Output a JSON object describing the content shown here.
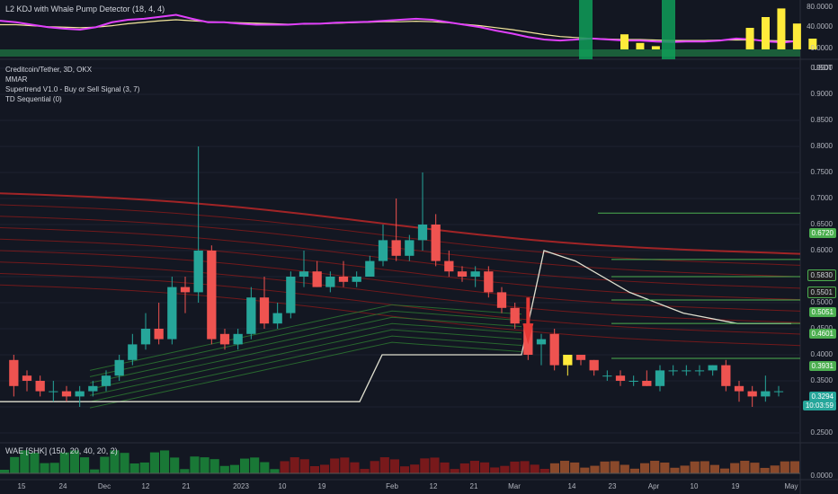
{
  "kdj_pane": {
    "title": "L2 KDJ with Whale Pump Detector (18, 4, 4)",
    "scale": [
      "80.0000",
      "40.0000",
      "0.0000"
    ]
  },
  "main_pane": {
    "legend": [
      "Creditcoin/Tether, 3D, OKX",
      "MMAR",
      "Supertrend V1.0 - Buy or Sell Signal (3, 7)",
      "TD Sequential (0)"
    ],
    "currency": "USDT",
    "scale": [
      "0.9500",
      "0.9000",
      "0.8500",
      "0.8000",
      "0.7500",
      "0.7000",
      "0.6500",
      "0.6000",
      "0.5500",
      "0.5000",
      "0.4500",
      "0.4000",
      "0.3500",
      "0.3000",
      "0.2500"
    ],
    "level_badges": [
      "0.6720",
      "0.5830",
      "0.5501",
      "0.5051",
      "0.4601",
      "0.3931"
    ],
    "last_price": "0.3294",
    "countdown": "10:03:59"
  },
  "wae_pane": {
    "title": "WAE [SHK] (150, 20, 40, 20, 2)",
    "scale": [
      "0.0000"
    ]
  },
  "time_axis": [
    "15",
    "24",
    "Dec",
    "12",
    "21",
    "2023",
    "10",
    "19",
    "Feb",
    "12",
    "21",
    "Mar",
    "14",
    "23",
    "Apr",
    "10",
    "19",
    "May"
  ],
  "colors": {
    "up": "#26a69a",
    "down": "#ef5350",
    "yellow": "#ffeb3b",
    "kdj_magenta": "#e040fb",
    "green_level": "#4caf50"
  },
  "chart_data": {
    "type": "candlestick",
    "title": "Creditcoin/Tether, 3D, OKX",
    "ylim": [
      0.25,
      0.95
    ],
    "candles": [
      {
        "o": 0.39,
        "h": 0.4,
        "l": 0.32,
        "c": 0.34
      },
      {
        "o": 0.36,
        "h": 0.37,
        "l": 0.33,
        "c": 0.35
      },
      {
        "o": 0.35,
        "h": 0.36,
        "l": 0.32,
        "c": 0.33
      },
      {
        "o": 0.33,
        "h": 0.35,
        "l": 0.31,
        "c": 0.33
      },
      {
        "o": 0.33,
        "h": 0.34,
        "l": 0.31,
        "c": 0.32
      },
      {
        "o": 0.32,
        "h": 0.34,
        "l": 0.3,
        "c": 0.33
      },
      {
        "o": 0.33,
        "h": 0.35,
        "l": 0.32,
        "c": 0.34
      },
      {
        "o": 0.34,
        "h": 0.37,
        "l": 0.33,
        "c": 0.36
      },
      {
        "o": 0.36,
        "h": 0.4,
        "l": 0.35,
        "c": 0.39
      },
      {
        "o": 0.39,
        "h": 0.44,
        "l": 0.38,
        "c": 0.42
      },
      {
        "o": 0.42,
        "h": 0.48,
        "l": 0.41,
        "c": 0.45
      },
      {
        "o": 0.45,
        "h": 0.5,
        "l": 0.42,
        "c": 0.43
      },
      {
        "o": 0.43,
        "h": 0.55,
        "l": 0.42,
        "c": 0.53
      },
      {
        "o": 0.53,
        "h": 0.55,
        "l": 0.48,
        "c": 0.52
      },
      {
        "o": 0.52,
        "h": 0.8,
        "l": 0.5,
        "c": 0.6
      },
      {
        "o": 0.6,
        "h": 0.61,
        "l": 0.42,
        "c": 0.43
      },
      {
        "o": 0.44,
        "h": 0.45,
        "l": 0.41,
        "c": 0.42
      },
      {
        "o": 0.42,
        "h": 0.45,
        "l": 0.41,
        "c": 0.44
      },
      {
        "o": 0.44,
        "h": 0.53,
        "l": 0.43,
        "c": 0.51
      },
      {
        "o": 0.51,
        "h": 0.55,
        "l": 0.45,
        "c": 0.46
      },
      {
        "o": 0.46,
        "h": 0.5,
        "l": 0.45,
        "c": 0.48
      },
      {
        "o": 0.48,
        "h": 0.56,
        "l": 0.47,
        "c": 0.55
      },
      {
        "o": 0.55,
        "h": 0.6,
        "l": 0.53,
        "c": 0.56
      },
      {
        "o": 0.56,
        "h": 0.58,
        "l": 0.53,
        "c": 0.53
      },
      {
        "o": 0.53,
        "h": 0.56,
        "l": 0.52,
        "c": 0.55
      },
      {
        "o": 0.55,
        "h": 0.58,
        "l": 0.53,
        "c": 0.54
      },
      {
        "o": 0.54,
        "h": 0.56,
        "l": 0.53,
        "c": 0.55
      },
      {
        "o": 0.55,
        "h": 0.59,
        "l": 0.55,
        "c": 0.58
      },
      {
        "o": 0.58,
        "h": 0.65,
        "l": 0.57,
        "c": 0.62
      },
      {
        "o": 0.62,
        "h": 0.7,
        "l": 0.58,
        "c": 0.59
      },
      {
        "o": 0.59,
        "h": 0.63,
        "l": 0.58,
        "c": 0.62
      },
      {
        "o": 0.62,
        "h": 0.75,
        "l": 0.6,
        "c": 0.65
      },
      {
        "o": 0.65,
        "h": 0.67,
        "l": 0.57,
        "c": 0.58
      },
      {
        "o": 0.58,
        "h": 0.6,
        "l": 0.55,
        "c": 0.56
      },
      {
        "o": 0.56,
        "h": 0.57,
        "l": 0.54,
        "c": 0.55
      },
      {
        "o": 0.55,
        "h": 0.57,
        "l": 0.53,
        "c": 0.56
      },
      {
        "o": 0.56,
        "h": 0.57,
        "l": 0.51,
        "c": 0.52
      },
      {
        "o": 0.52,
        "h": 0.53,
        "l": 0.48,
        "c": 0.49
      },
      {
        "o": 0.49,
        "h": 0.5,
        "l": 0.45,
        "c": 0.46
      },
      {
        "o": 0.46,
        "h": 0.48,
        "l": 0.39,
        "c": 0.4
      },
      {
        "o": 0.42,
        "h": 0.44,
        "l": 0.38,
        "c": 0.43
      },
      {
        "o": 0.44,
        "h": 0.45,
        "l": 0.37,
        "c": 0.38
      },
      {
        "o": 0.38,
        "h": 0.4,
        "l": 0.36,
        "c": 0.4
      },
      {
        "o": 0.4,
        "h": 0.4,
        "l": 0.38,
        "c": 0.39
      },
      {
        "o": 0.39,
        "h": 0.39,
        "l": 0.36,
        "c": 0.37
      },
      {
        "o": 0.36,
        "h": 0.37,
        "l": 0.35,
        "c": 0.36
      },
      {
        "o": 0.36,
        "h": 0.37,
        "l": 0.34,
        "c": 0.35
      },
      {
        "o": 0.35,
        "h": 0.36,
        "l": 0.34,
        "c": 0.35
      },
      {
        "o": 0.35,
        "h": 0.37,
        "l": 0.34,
        "c": 0.34
      },
      {
        "o": 0.34,
        "h": 0.38,
        "l": 0.33,
        "c": 0.37
      },
      {
        "o": 0.37,
        "h": 0.38,
        "l": 0.36,
        "c": 0.37
      },
      {
        "o": 0.37,
        "h": 0.38,
        "l": 0.36,
        "c": 0.37
      },
      {
        "o": 0.37,
        "h": 0.38,
        "l": 0.36,
        "c": 0.37
      },
      {
        "o": 0.37,
        "h": 0.38,
        "l": 0.36,
        "c": 0.38
      },
      {
        "o": 0.38,
        "h": 0.39,
        "l": 0.33,
        "c": 0.34
      },
      {
        "o": 0.34,
        "h": 0.35,
        "l": 0.31,
        "c": 0.33
      },
      {
        "o": 0.33,
        "h": 0.34,
        "l": 0.3,
        "c": 0.32
      },
      {
        "o": 0.32,
        "h": 0.36,
        "l": 0.31,
        "c": 0.33
      },
      {
        "o": 0.33,
        "h": 0.34,
        "l": 0.32,
        "c": 0.33
      }
    ],
    "kdj": {
      "k": [
        58,
        55,
        50,
        45,
        42,
        40,
        45,
        55,
        60,
        62,
        66,
        70,
        62,
        55,
        55,
        52,
        50,
        50,
        50,
        52,
        52,
        54,
        55,
        56,
        58,
        60,
        62,
        60,
        55,
        50,
        45,
        38,
        32,
        25,
        20,
        18,
        20,
        22,
        20,
        18,
        18,
        16,
        15,
        16,
        16,
        18,
        22,
        20,
        16,
        14,
        18
      ],
      "d": [
        50,
        50,
        48,
        46,
        45,
        44,
        45,
        48,
        52,
        55,
        58,
        60,
        58,
        56,
        55,
        54,
        53,
        52,
        51,
        51,
        52,
        53,
        54,
        55,
        56,
        56,
        57,
        56,
        54,
        51,
        48,
        44,
        40,
        35,
        30,
        26,
        24,
        22,
        21,
        20,
        20,
        19,
        18,
        18,
        18,
        19,
        19,
        19,
        18,
        17,
        17
      ],
      "pump_bars": [
        0,
        0,
        0,
        0,
        0,
        0,
        0,
        0,
        0,
        0,
        0,
        0,
        0,
        0,
        0,
        0,
        0,
        0,
        0,
        0,
        0,
        0,
        0,
        0,
        0,
        0,
        0,
        0,
        0,
        0,
        0,
        0,
        0,
        0,
        0,
        0,
        0,
        0,
        0,
        0,
        0,
        0,
        28,
        12,
        6,
        0,
        0,
        0,
        0,
        0,
        40,
        60,
        76,
        48,
        20
      ]
    },
    "horizontal_levels": [
      0.672,
      0.583,
      0.5501,
      0.5051,
      0.4601,
      0.3931
    ]
  }
}
